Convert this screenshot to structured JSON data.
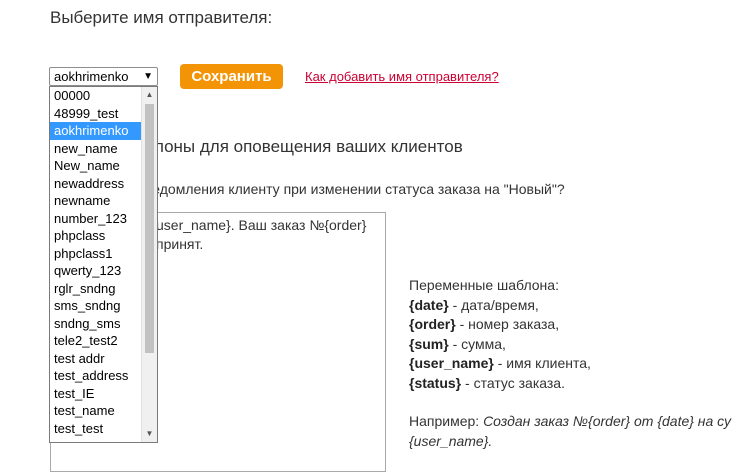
{
  "heading": "Выберите имя отправителя:",
  "sender_select": {
    "value": "aokhrimenko",
    "arrow": "▼"
  },
  "save_button": "Сохранить",
  "help_link": "Как добавить имя отправителя?",
  "dropdown": {
    "options": [
      "00000",
      "48999_test",
      "aokhrimenko",
      "new_name",
      "New_name",
      "newaddress",
      "newname",
      "number_123",
      "phpclass",
      "phpclass1",
      "qwerty_123",
      "rglr_sndng",
      "sms_sndng",
      "sndng_sms",
      "tele2_test2",
      "test addr",
      "test_address",
      "test_IE",
      "test_name",
      "test_test"
    ],
    "selected_index": 2,
    "scroll_up": "▲",
    "scroll_down": "▼"
  },
  "section_title": "блоны для оповещения ваших клиентов",
  "question": "ведомления клиенту при изменении статуса заказа на \"Новый\"?",
  "template_text": "user_name}. Ваш заказ №{order}\nпринят.",
  "vars": {
    "title": "Переменные шаблона:",
    "items": [
      {
        "var": "{date}",
        "desc": " - дата/время,"
      },
      {
        "var": "{order}",
        "desc": " - номер заказа,"
      },
      {
        "var": "{sum}",
        "desc": " - сумма,"
      },
      {
        "var": "{user_name}",
        "desc": " - имя клиента,"
      },
      {
        "var": "{status}",
        "desc": " - статус заказа."
      }
    ],
    "example_label": "Например: ",
    "example_text": "Создан заказ №{order} от {date} на су",
    "example_text2": "{user_name}."
  }
}
